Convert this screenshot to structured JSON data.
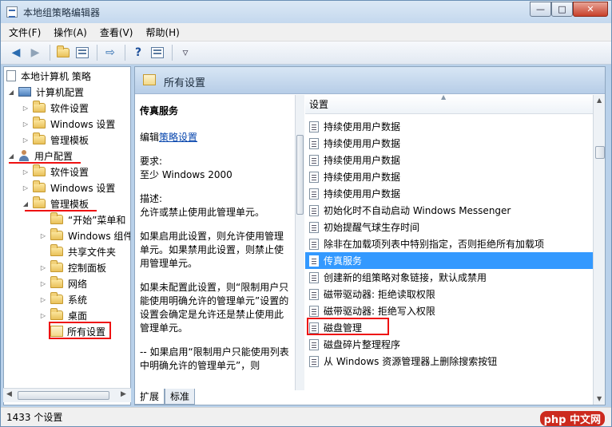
{
  "window": {
    "title": "本地组策略编辑器",
    "minimize": "—",
    "maximize": "□",
    "close": "✕"
  },
  "menu": [
    "文件(F)",
    "操作(A)",
    "查看(V)",
    "帮助(H)"
  ],
  "toolbar": {
    "icons": [
      "back-arrow-icon",
      "forward-arrow-icon",
      "up-folder-icon",
      "show-hide-tree-icon",
      "export-icon",
      "help-icon",
      "properties-icon",
      "filter-icon"
    ]
  },
  "tree": {
    "root": "本地计算机 策略",
    "computer_config": "计算机配置",
    "cc_children": [
      "软件设置",
      "Windows 设置",
      "管理模板"
    ],
    "user_config": "用户配置",
    "uc_children": [
      "软件设置",
      "Windows 设置"
    ],
    "admin_templates": "管理模板",
    "at_children": [
      "“开始”菜单和",
      "Windows 组件",
      "共享文件夹",
      "控制面板",
      "网络",
      "系统",
      "桌面"
    ],
    "all_settings": "所有设置"
  },
  "content": {
    "header_title": "所有设置",
    "desc": {
      "title": "传真服务",
      "edit_prefix": "编辑",
      "edit_link": "策略设置",
      "req_label": "要求:",
      "req_value": "至少 Windows 2000",
      "desc_label": "描述:",
      "desc_text": "允许或禁止使用此管理单元。",
      "p1": "如果启用此设置，则允许使用管理单元。如果禁用此设置，则禁止使用管理单元。",
      "p2": "如果未配置此设置，则“限制用户只能使用明确允许的管理单元”设置的设置会确定是允许还是禁止使用此管理单元。",
      "p3": "-- 如果启用“限制用户只能使用列表中明确允许的管理单元”，则"
    },
    "list_header": "设置",
    "rows": [
      "持续使用用户数据",
      "持续使用用户数据",
      "持续使用用户数据",
      "持续使用用户数据",
      "持续使用用户数据",
      "初始化时不自动启动 Windows Messenger",
      "初始提醒气球生存时间",
      "除非在加载项列表中特别指定，否则拒绝所有加载项",
      "传真服务",
      "创建新的组策略对象链接，默认成禁用",
      "磁带驱动器: 拒绝读取权限",
      "磁带驱动器: 拒绝写入权限",
      "磁盘管理",
      "磁盘碎片整理程序",
      "从 Windows 资源管理器上删除搜索按钮"
    ],
    "selected_index": 8
  },
  "tabs": [
    "扩展",
    "标准"
  ],
  "status": "1433 个设置",
  "watermark": "php 中文网"
}
